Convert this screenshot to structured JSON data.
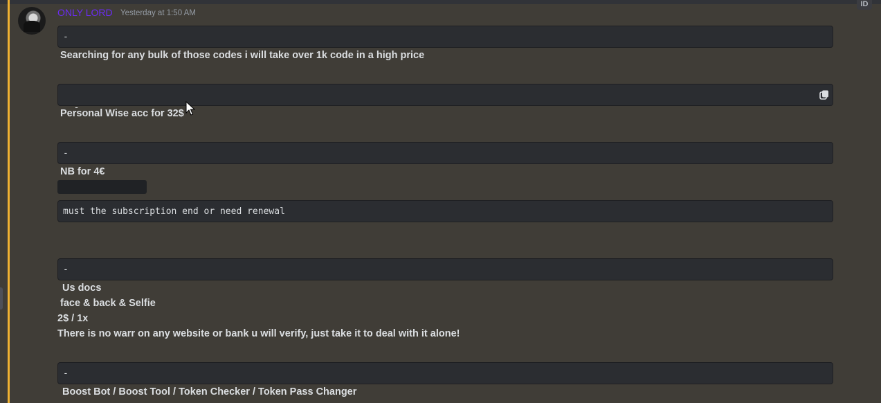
{
  "message": {
    "author": "ONLY LORD",
    "timestamp": "Yesterday at 1:50 AM"
  },
  "badges": {
    "id_label": "ID"
  },
  "blocks": {
    "b1": {
      "code": "-",
      "text": "Searching for any bulk of those codes i will take over 1k code in a high price"
    },
    "b2": {
      "code": "-",
      "text": "Personal Wise acc for 32$"
    },
    "b3": {
      "code": "-",
      "text": "NB for 4€"
    },
    "b4": {
      "code": "must the subscription end or need renewal"
    },
    "b5": {
      "code": "-",
      "line1": "Us docs",
      "line2": "face & back & Selfie",
      "line3": "2$ / 1x",
      "line4": "There is no warr on any website or bank u will verify, just take it to deal with it alone!"
    },
    "b6": {
      "code": "-",
      "text": "Boost Bot / Boost Tool / Token Checker / Token Pass Changer"
    }
  },
  "colors": {
    "username": "#6b2cf5",
    "background": "#403d37",
    "mention_bar": "#f0b232",
    "codeblock_bg": "#2b2d31"
  },
  "icons": {
    "copy": "copy-icon",
    "cursor": "mouse-pointer-icon"
  }
}
